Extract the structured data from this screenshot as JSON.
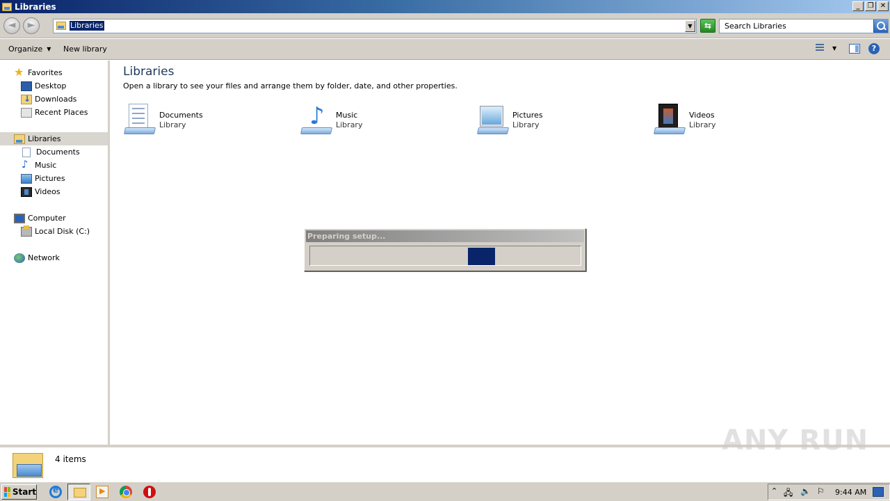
{
  "window": {
    "title": "Libraries",
    "minimize": "_",
    "restore": "❐",
    "close": "✕"
  },
  "nav": {
    "back": "◄",
    "forward": "►",
    "address": "Libraries",
    "refresh": "⇆",
    "search_placeholder": "Search Libraries"
  },
  "toolbar": {
    "organize": "Organize",
    "new_library": "New library"
  },
  "sidebar": {
    "favorites": "Favorites",
    "desktop": "Desktop",
    "downloads": "Downloads",
    "recent_places": "Recent Places",
    "libraries": "Libraries",
    "documents": "Documents",
    "music": "Music",
    "pictures": "Pictures",
    "videos": "Videos",
    "computer": "Computer",
    "local_disk": "Local Disk (C:)",
    "network": "Network"
  },
  "main": {
    "title": "Libraries",
    "description": "Open a library to see your files and arrange them by folder, date, and other properties.",
    "libraries": [
      {
        "name": "Documents",
        "type": "Library",
        "icon": "documents-library-icon"
      },
      {
        "name": "Music",
        "type": "Library",
        "icon": "music-library-icon"
      },
      {
        "name": "Pictures",
        "type": "Library",
        "icon": "pictures-library-icon"
      },
      {
        "name": "Videos",
        "type": "Library",
        "icon": "videos-library-icon"
      }
    ]
  },
  "status": {
    "count": "4 items"
  },
  "dialog": {
    "title": "Preparing setup..."
  },
  "taskbar": {
    "start": "Start",
    "clock": "9:44 AM"
  },
  "watermark": "ANY RUN",
  "colors": {
    "selection": "#0a246a",
    "progress": "#0a246a",
    "title_gradient_start": "#0a246a"
  }
}
